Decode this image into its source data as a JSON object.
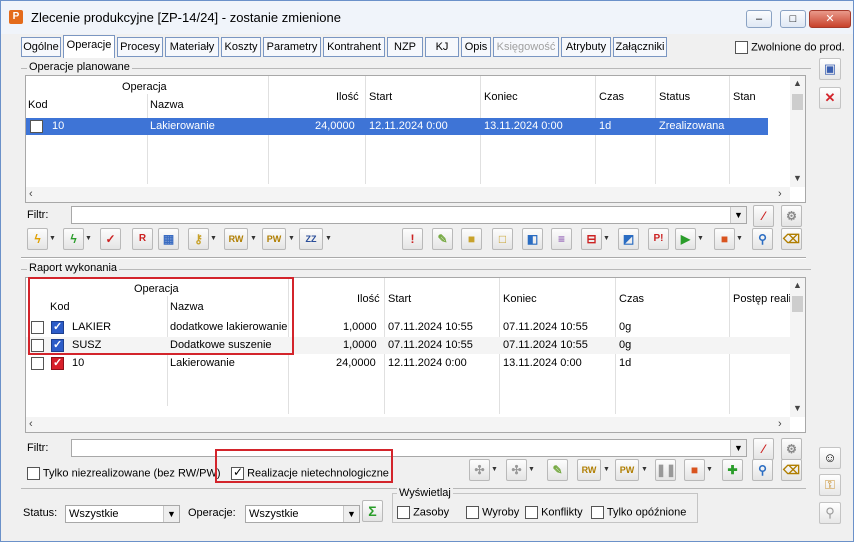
{
  "window": {
    "title": "Zlecenie produkcyjne  [ZP-14/24] - zostanie zmienione",
    "icon": "P",
    "controls": [
      "–",
      "□",
      "✕"
    ]
  },
  "tabs": [
    {
      "label": "Ogólne"
    },
    {
      "label": "Operacje"
    },
    {
      "label": "Procesy"
    },
    {
      "label": "Materiały"
    },
    {
      "label": "Koszty"
    },
    {
      "label": "Parametry"
    },
    {
      "label": "Kontrahent"
    },
    {
      "label": "NZP"
    },
    {
      "label": "KJ"
    },
    {
      "label": "Opis"
    },
    {
      "label": "Księgowość"
    },
    {
      "label": "Atrybuty"
    },
    {
      "label": "Załączniki"
    }
  ],
  "zwolnione_label": "Zwolnione do prod.",
  "planned": {
    "section_label": "Operacje planowane",
    "group_header": "Operacja",
    "columns": {
      "kod": "Kod",
      "nazwa": "Nazwa",
      "ilosc": "Ilość",
      "start": "Start",
      "koniec": "Koniec",
      "czas": "Czas",
      "status": "Status",
      "stan": "Stan"
    },
    "rows": [
      {
        "kod": "10",
        "nazwa": "Lakierowanie",
        "ilosc": "24,0000",
        "start": "12.11.2024 0:00",
        "koniec": "13.11.2024 0:00",
        "czas": "1d",
        "status": "Zrealizowana",
        "stan": ""
      }
    ]
  },
  "filter_label": "Filtr:",
  "report": {
    "section_label": "Raport wykonania",
    "group_header": "Operacja",
    "columns": {
      "kod": "Kod",
      "nazwa": "Nazwa",
      "ilosc": "Ilość",
      "start": "Start",
      "koniec": "Koniec",
      "czas": "Czas",
      "postep": "Postęp reali"
    },
    "rows": [
      {
        "kod": "LAKIER",
        "nazwa": "dodatkowe lakierowanie",
        "ilosc": "1,0000",
        "start": "07.11.2024 10:55",
        "koniec": "07.11.2024 10:55",
        "czas": "0g"
      },
      {
        "kod": "SUSZ",
        "nazwa": "Dodatkowe suszenie",
        "ilosc": "1,0000",
        "start": "07.11.2024 10:55",
        "koniec": "07.11.2024 10:55",
        "czas": "0g"
      },
      {
        "kod": "10",
        "nazwa": "Lakierowanie",
        "ilosc": "24,0000",
        "start": "12.11.2024 0:00",
        "koniec": "13.11.2024 0:00",
        "czas": "1d"
      }
    ]
  },
  "options": {
    "tylko_label": "Tylko niezrealizowane (bez RW/PW)",
    "realizacje_label": "Realizacje nietechnologiczne"
  },
  "bottom": {
    "status_label": "Status:",
    "status_value": "Wszystkie",
    "operacje_label": "Operacje:",
    "operacje_value": "Wszystkie",
    "wyswietlaj_label": "Wyświetlaj",
    "zasoby": "Zasoby",
    "wyroby": "Wyroby",
    "konflikty": "Konflikty",
    "opoznione": "Tylko opóźnione"
  },
  "toolbar_icons": {
    "rw": "RW",
    "pw": "PW",
    "zz": "ZZ",
    "sigma": "Σ"
  },
  "accent": "#3e74d6",
  "highlight": "#d3242b"
}
